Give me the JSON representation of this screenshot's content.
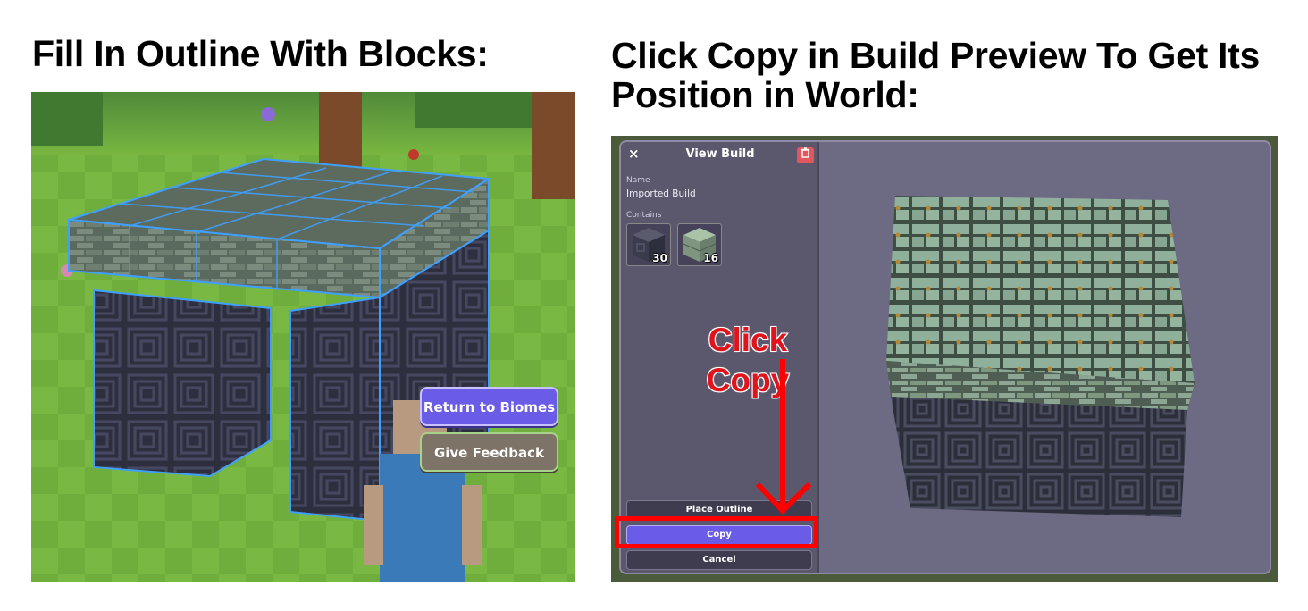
{
  "left": {
    "heading": "Fill In Outline With Blocks:",
    "return_button": "Return to Biomes",
    "feedback_button": "Give Feedback"
  },
  "right": {
    "heading_line1": "Click Copy in Build Preview To Get Its",
    "heading_line2": "Position in World:",
    "dialog": {
      "close_glyph": "×",
      "title": "View Build",
      "name_label": "Name",
      "name_value": "Imported Build",
      "contains_label": "Contains",
      "items": [
        {
          "icon": "dark-spiral-stone-block-icon",
          "count": "30"
        },
        {
          "icon": "mossy-stone-brick-block-icon",
          "count": "16"
        }
      ],
      "place_outline_label": "Place Outline",
      "copy_label": "Copy",
      "cancel_label": "Cancel"
    },
    "annotation": {
      "line1": "Click",
      "line2": "Copy",
      "color": "#e0141c"
    }
  },
  "colors": {
    "accent_purple": "#6b5ce7",
    "highlight_red": "#ff0000",
    "outline_blue": "#3fa0ff"
  }
}
